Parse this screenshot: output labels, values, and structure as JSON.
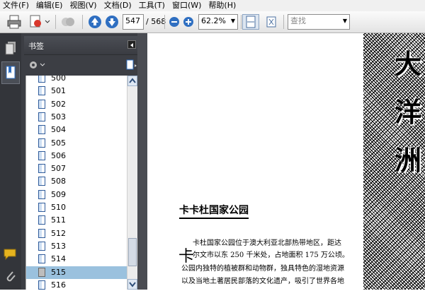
{
  "menu": [
    "文件(F)",
    "编辑(E)",
    "视图(V)",
    "文档(D)",
    "工具(T)",
    "窗口(W)",
    "帮助(H)"
  ],
  "toolbar": {
    "page_current": "547",
    "page_total": "/ 568",
    "zoom": "62.2%",
    "search_placeholder": "查找"
  },
  "panel": {
    "title": "书签",
    "items": [
      "500",
      "501",
      "502",
      "503",
      "504",
      "505",
      "506",
      "507",
      "508",
      "509",
      "510",
      "511",
      "512",
      "513",
      "514",
      "515",
      "516"
    ],
    "selected": "515"
  },
  "document": {
    "art_title": [
      "大",
      "洋",
      "洲"
    ],
    "heading": "卡卡杜国家公园",
    "dropcap": "卡",
    "lines": [
      "卡杜国家公园位于澳大利亚北部热带地区，距达",
      "尔文市以东 250 千米处，占地面积 175 万公顷。",
      "公园内独特的植被群和动物群，独具特色的湿地资源",
      "以及当地土著居民部落的文化遗产，吸引了世界各地"
    ]
  },
  "colors": {
    "accent_blue": "#2f6fc1",
    "selection": "#9ac1de",
    "panel_bg": "#3c3e44",
    "rail_bg": "#33353a"
  }
}
